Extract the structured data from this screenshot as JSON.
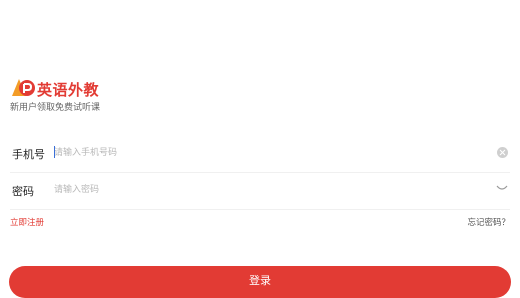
{
  "brand": {
    "name": "英语外教",
    "tagline": "新用户领取免费试听课",
    "colors": {
      "primary": "#e23b34",
      "accent": "#f39c27"
    }
  },
  "form": {
    "phone": {
      "label": "手机号",
      "placeholder": "请输入手机号码",
      "value": "",
      "action_icon": "clear-icon"
    },
    "password": {
      "label": "密码",
      "placeholder": "请输入密码",
      "value": "",
      "action_icon": "eye-closed-icon"
    }
  },
  "links": {
    "register": "立即注册",
    "forgot": "忘记密码？"
  },
  "login_button": "登录"
}
